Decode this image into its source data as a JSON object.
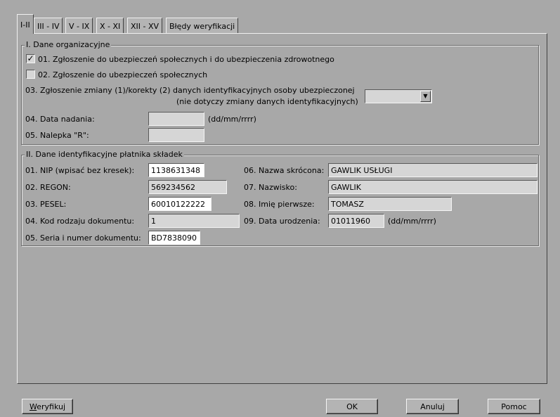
{
  "tabs": [
    {
      "label": "I-II"
    },
    {
      "label": "III - IV"
    },
    {
      "label": "V - IX"
    },
    {
      "label": "X - XI"
    },
    {
      "label": "XII - XV"
    },
    {
      "label": "Błędy weryfikacji"
    }
  ],
  "section1": {
    "legend": "I. Dane organizacyjne",
    "item01": {
      "label": "01. Zgłoszenie do ubezpieczeń społecznych i do ubezpieczenia zdrowotnego",
      "checked": true,
      "mark": "✓"
    },
    "item02": {
      "label": "02. Zgłoszenie do ubezpieczeń społecznych",
      "checked": false
    },
    "item03": {
      "label_line1": "03. Zgłoszenie zmiany (1)/korekty (2) danych identyfikacyjnych osoby ubezpieczonej",
      "label_line2": "(nie dotyczy zmiany danych identyfikacyjnych)",
      "value": ""
    },
    "item04": {
      "label": "04. Data nadania:",
      "value": "",
      "hint": "(dd/mm/rrrr)"
    },
    "item05": {
      "label": "05. Nalepka \"R\":",
      "value": ""
    }
  },
  "section2": {
    "legend": "II. Dane identyfikacyjne płatnika składek",
    "nip": {
      "label": "01. NIP (wpisać bez kresek):",
      "value": "1138631348"
    },
    "regon": {
      "label": "02. REGON:",
      "value": "569234562"
    },
    "pesel": {
      "label": "03. PESEL:",
      "value": "60010122222"
    },
    "kod_dok": {
      "label": "04. Kod rodzaju dokumentu:",
      "value": "1"
    },
    "seria_dok": {
      "label": "05. Seria i numer dokumentu:",
      "value": "BD7838090"
    },
    "nazwa": {
      "label": "06. Nazwa skrócona:",
      "value": "GAWLIK USŁUGI"
    },
    "nazwisko": {
      "label": "07. Nazwisko:",
      "value": "GAWLIK"
    },
    "imie": {
      "label": "08. Imię pierwsze:",
      "value": "TOMASZ"
    },
    "data_ur": {
      "label": "09. Data urodzenia:",
      "value": "01011960",
      "hint": "(dd/mm/rrrr)"
    }
  },
  "buttons": {
    "weryfikuj_first": "W",
    "weryfikuj_rest": "eryfikuj",
    "ok": "OK",
    "anuluj": "Anuluj",
    "pomoc": "Pomoc"
  },
  "icons": {
    "combo_arrow": "▼"
  }
}
